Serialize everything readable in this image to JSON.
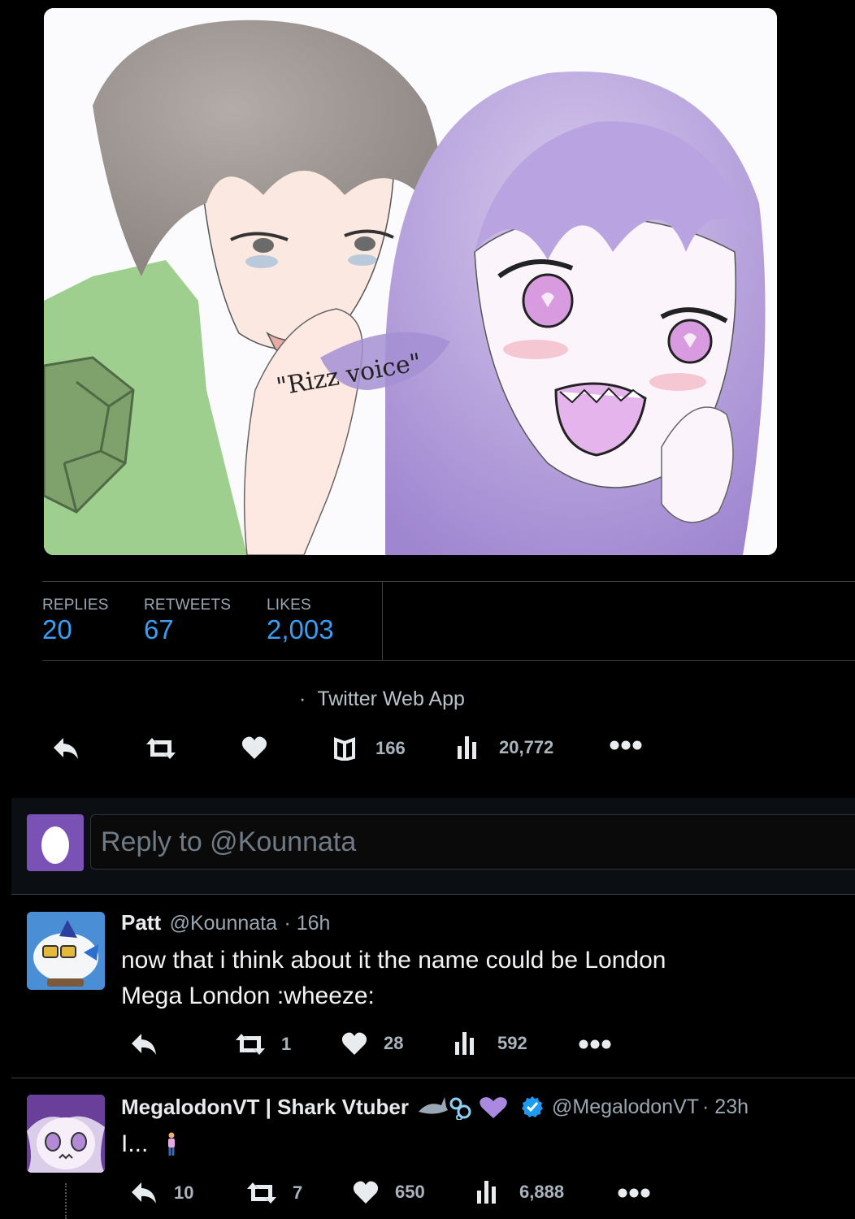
{
  "media": {
    "caption_text": "\"Rizz voice\""
  },
  "stats": [
    {
      "label": "REPLIES",
      "value": "20"
    },
    {
      "label": "RETWEETS",
      "value": "67"
    },
    {
      "label": "LIKES",
      "value": "2,003"
    }
  ],
  "source": {
    "separator": "·",
    "app": "Twitter Web App"
  },
  "main_actions": {
    "bookmarks": "166",
    "views": "20,772"
  },
  "composer": {
    "placeholder": "Reply to @Kounnata"
  },
  "replies": [
    {
      "name": "Patt",
      "handle": "@Kounnata",
      "time": "· 16h",
      "lines": [
        "now that i think about it the name could be London",
        "Mega London :wheeze:"
      ],
      "retweets": "1",
      "likes": "28",
      "views": "592"
    },
    {
      "name": "MegalodonVT | Shark Vtuber",
      "handle": "@MegalodonVT",
      "time": "· 23h",
      "text": "I...",
      "replies": "10",
      "retweets": "7",
      "likes": "650",
      "views": "6,888"
    }
  ],
  "colors": {
    "accent": "#3a9ef2",
    "composer_avatar": "#7a52b6",
    "verified": "#1d9bf0"
  }
}
